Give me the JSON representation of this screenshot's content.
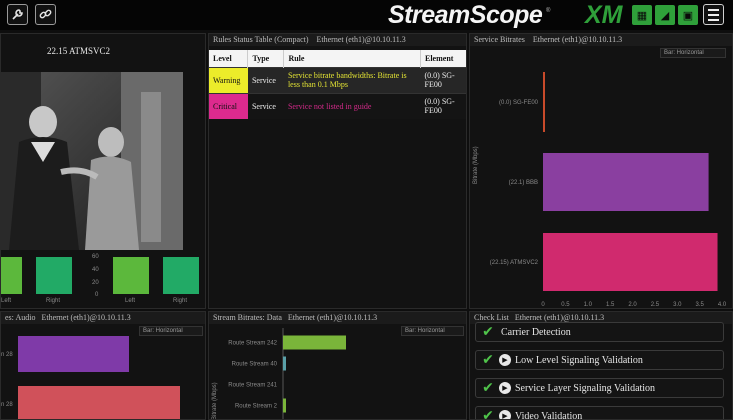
{
  "header": {
    "brand": "StreamScope",
    "brand_mark": "®",
    "product": "XM",
    "icons": [
      "wrench-icon",
      "link-icon",
      "grid-icon",
      "signal-icon",
      "tv-icon",
      "lock-icon",
      "menu-icon"
    ]
  },
  "video_panel": {
    "service_name": "22.15 ATMSVC2",
    "audio_labels": [
      "Left",
      "Right",
      "Left",
      "Right"
    ],
    "audio_ticks": [
      "60",
      "40",
      "20",
      "0"
    ]
  },
  "rules_panel": {
    "title": "Rules Status Table (Compact)",
    "interface": "Ethernet (eth1)@10.10.11.3",
    "columns": [
      "Level",
      "Type",
      "Rule",
      "Element"
    ],
    "rows": [
      {
        "level": "Warning",
        "type": "Service",
        "rule": "Service bitrate bandwidths: Bitrate is less than 0.1 Mbps",
        "element": "(0.0) SG-FE00"
      },
      {
        "level": "Critical",
        "type": "Service",
        "rule": "Service not listed in guide",
        "element": "(0.0) SG-FE00"
      }
    ]
  },
  "service_bitrates": {
    "title": "Service Bitrates",
    "interface": "Ethernet (eth1)@10.10.11.3",
    "dropdown": "Bar: Horizontal",
    "ylabel": "Bitrate (Mbps)"
  },
  "stream_bitrates": {
    "title": "Stream Bitrates: Data",
    "interface": "Ethernet (eth1)@10.10.11.3",
    "dropdown": "Bar: Horizontal",
    "ylabel": "Bitrate (Mbps)"
  },
  "audio_bitrates": {
    "title": "es: Audio",
    "interface": "Ethernet (eth1)@10.10.11.3",
    "dropdown": "Bar: Horizontal",
    "labels": [
      "n 28",
      "n 28"
    ]
  },
  "checklist": {
    "title": "Check List",
    "interface": "Ethernet (eth1)@10.10.11.3",
    "items": [
      {
        "label": "Carrier Detection",
        "expandable": false
      },
      {
        "label": "Low Level Signaling Validation",
        "expandable": true
      },
      {
        "label": "Service Layer Signaling Validation",
        "expandable": true
      },
      {
        "label": "Video Validation",
        "expandable": true
      }
    ]
  },
  "colors": {
    "accent": "#2fa03a",
    "warning": "#ecec2a",
    "critical": "#dc2a8e",
    "bar_orange": "#c84a2a",
    "bar_purple": "#8a3fa0",
    "bar_magenta": "#d02a6e",
    "bar_green": "#7ab53a",
    "bar_audio": "#22aa66"
  },
  "chart_data": [
    {
      "type": "bar",
      "orientation": "horizontal",
      "categories": [
        "(0.0) SG-FE00",
        "(22.1) BBB",
        "(22.15) ATMSVC2"
      ],
      "values": [
        0.01,
        3.7,
        3.9
      ],
      "xticks": [
        "0",
        "0.5",
        "1.0",
        "1.5",
        "2.0",
        "2.5",
        "3.0",
        "3.5",
        "4.0"
      ],
      "xlim": [
        0,
        4.0
      ],
      "ylabel": "Bitrate (Mbps)",
      "colors": [
        "#c84a2a",
        "#8a3fa0",
        "#d02a6e"
      ]
    },
    {
      "type": "bar",
      "orientation": "horizontal",
      "categories": [
        "Route Stream 242",
        "Route Stream 40",
        "Route Stream 241",
        "Route Stream 2",
        ""
      ],
      "values": [
        0.55,
        0.01,
        0,
        0.04,
        0.04
      ],
      "xlim": [
        0,
        1.0
      ],
      "ylabel": "Bitrate (Mbps)"
    }
  ]
}
